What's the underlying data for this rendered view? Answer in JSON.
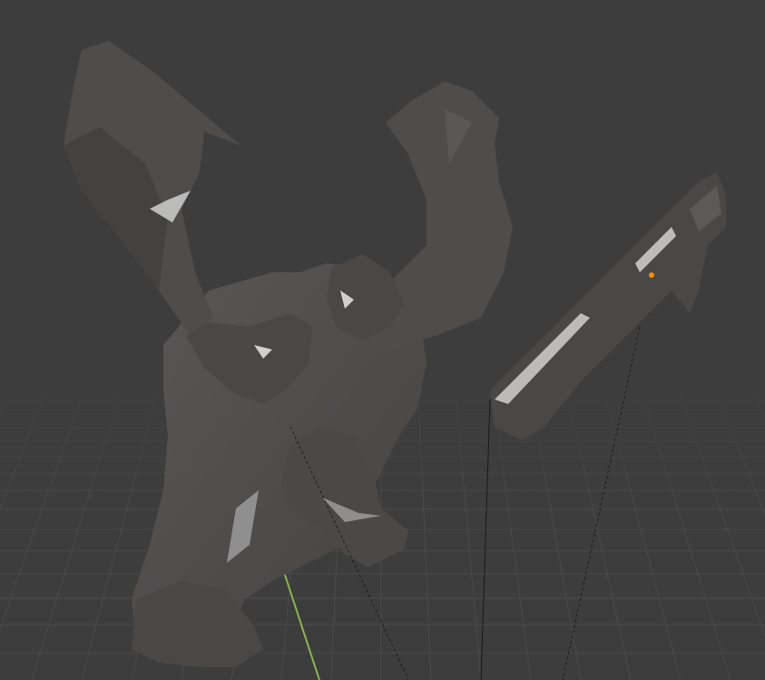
{
  "viewport": {
    "background": "#3d3d3d",
    "grid_color": "#4a4a4a",
    "grid_minor_color": "#434343"
  },
  "scene": {
    "mesh_color": "#4f4d4c",
    "mesh_shadow": "#3a3938",
    "mesh_highlight": "#cfcfcf",
    "axis_y_color": "#8ab64a",
    "origin_color": "#ff8a00",
    "relationship_line_color": "#1a1a1a",
    "objects": [
      "creature-mesh",
      "rifle-mesh"
    ]
  }
}
